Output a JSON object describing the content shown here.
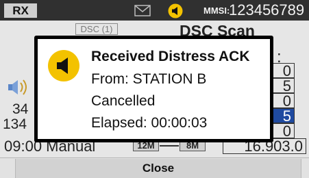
{
  "status_bar": {
    "rx_label": "RX",
    "envelope_icon": "envelope-icon",
    "speaker_icon": "speaker-icon",
    "mmsi_label": "MMSI:",
    "mmsi_value": "123456789"
  },
  "background": {
    "dsc_tag": "DSC (1)",
    "title": "DSC Scan",
    "colon": ":",
    "list_values": [
      "0",
      "5",
      "0",
      "5",
      "0"
    ],
    "row_34": "34",
    "row_134": "134",
    "manual_text": "09:00 Manual",
    "pill_left": "12M",
    "pill_right": "8M",
    "freq_value": "16.903.0"
  },
  "dialog": {
    "icon": "speaker-alert-icon",
    "title": "Received Distress ACK",
    "from": "From: STATION B",
    "status": "Cancelled",
    "elapsed": "Elapsed: 00:00:03"
  },
  "buttons": {
    "close_label": "Close"
  },
  "colors": {
    "status_bar": "#303030",
    "alert_yellow": "#f3c200",
    "highlight_blue": "#1f4aa0"
  }
}
